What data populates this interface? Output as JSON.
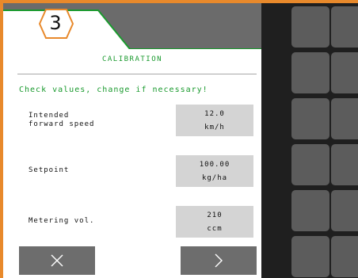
{
  "step": {
    "number": "3"
  },
  "screen": {
    "title": "CALIBRATION",
    "hint": "Check values, change if necessary!"
  },
  "rows": [
    {
      "label": "Intended\nforward speed",
      "value": "12.0",
      "unit": "km/h"
    },
    {
      "label": "Setpoint",
      "value": "100.00",
      "unit": "kg/ha"
    },
    {
      "label": "Metering vol.",
      "value": "210",
      "unit": "ccm"
    }
  ],
  "buttons": {
    "cancel_icon": "close-icon",
    "next_icon": "chevron-right-icon"
  },
  "colors": {
    "accent_green": "#1a9a2e",
    "frame_orange": "#e8892b",
    "header_gray": "#6b6b6b",
    "button_gray": "#6d6d6d",
    "value_box": "#d4d4d4"
  }
}
